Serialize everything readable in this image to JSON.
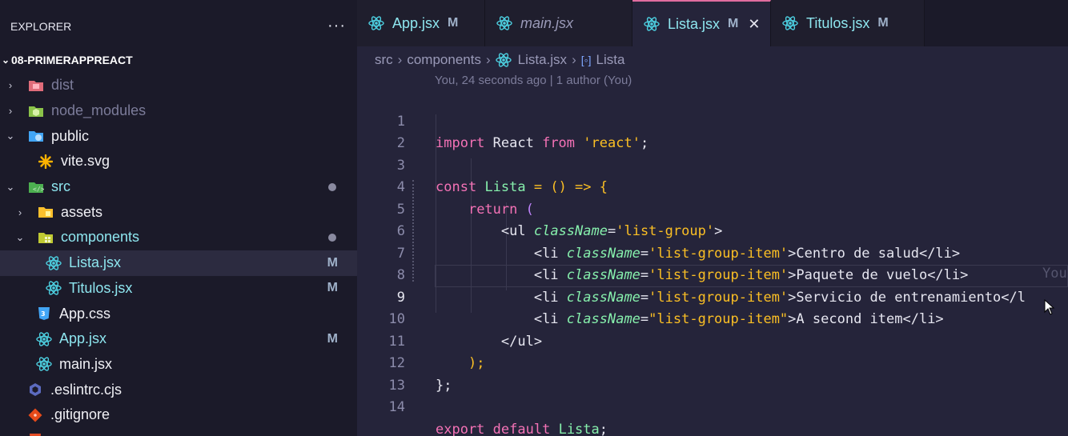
{
  "sidebar": {
    "title": "EXPLORER",
    "more_label": "···",
    "project": "08-PRIMERAPPREACT",
    "items": [
      {
        "label": "dist",
        "chevron": ">",
        "icon": "folder-dist-icon",
        "color": "#7c7c9a"
      },
      {
        "label": "node_modules",
        "chevron": ">",
        "icon": "folder-node-icon",
        "color": "#7c7c9a"
      },
      {
        "label": "public",
        "chevron": "v",
        "icon": "folder-public-icon",
        "color": "#f0f0f5"
      },
      {
        "label": "vite.svg",
        "icon": "vite-icon",
        "color": "#f0f0f5"
      },
      {
        "label": "src",
        "chevron": "v",
        "icon": "folder-src-icon",
        "color": "#8ee6ef",
        "dot": true
      },
      {
        "label": "assets",
        "chevron": ">",
        "icon": "folder-assets-icon",
        "color": "#f0f0f5"
      },
      {
        "label": "components",
        "chevron": "v",
        "icon": "folder-components-icon",
        "color": "#8ee6ef",
        "dot": true
      },
      {
        "label": "Lista.jsx",
        "icon": "react-icon",
        "color": "#8ee6ef",
        "status": "M",
        "selected": true
      },
      {
        "label": "Titulos.jsx",
        "icon": "react-icon",
        "color": "#8ee6ef",
        "status": "M"
      },
      {
        "label": "App.css",
        "icon": "css-icon",
        "color": "#f0f0f5"
      },
      {
        "label": "App.jsx",
        "icon": "react-icon",
        "color": "#8ee6ef",
        "status": "M"
      },
      {
        "label": "main.jsx",
        "icon": "react-icon",
        "color": "#f0f0f5"
      },
      {
        "label": ".eslintrc.cjs",
        "icon": "eslint-icon",
        "color": "#f0f0f5"
      },
      {
        "label": ".gitignore",
        "icon": "git-icon",
        "color": "#f0f0f5"
      }
    ]
  },
  "tabs": [
    {
      "label": "App.jsx",
      "mark": "M"
    },
    {
      "label": "main.jsx",
      "mark": ""
    },
    {
      "label": "Lista.jsx",
      "mark": "M",
      "close": "✕"
    },
    {
      "label": "Titulos.jsx",
      "mark": "M"
    }
  ],
  "breadcrumb": {
    "parts": [
      "src",
      "components",
      "Lista.jsx"
    ],
    "symbol": "Lista"
  },
  "codelens": "You, 24 seconds ago | 1 author (You)",
  "ghost_text": "You",
  "code": {
    "line_numbers": [
      "1",
      "2",
      "3",
      "4",
      "5",
      "6",
      "7",
      "8",
      "9",
      "10",
      "11",
      "12",
      "13",
      "14"
    ],
    "import_kw": "import",
    "react_id": " React ",
    "from_kw": "from",
    "react_str": "'react'",
    "semi": ";",
    "const_kw": "const",
    "lista": "Lista",
    "arrow": " = () => {",
    "return_kw": "return",
    "open_paren": " (",
    "ul_open": "<ul",
    "classname": "className",
    "list_group": "'list-group'",
    "gt": ">",
    "li_open": "<li",
    "item_cls": "'list-group-item'",
    "item_cls_dq": "\"list-group-item\"",
    "eq": "=",
    "li_close": "</li>",
    "items": [
      "Centro de salud",
      "Paquete de vuelo",
      "Servicio de entrenamiento</l",
      "A second item"
    ],
    "ul_close": "</ul>",
    "close_paren": ");",
    "close_brace": "};",
    "export_kw": "export",
    "default_kw": "default"
  }
}
